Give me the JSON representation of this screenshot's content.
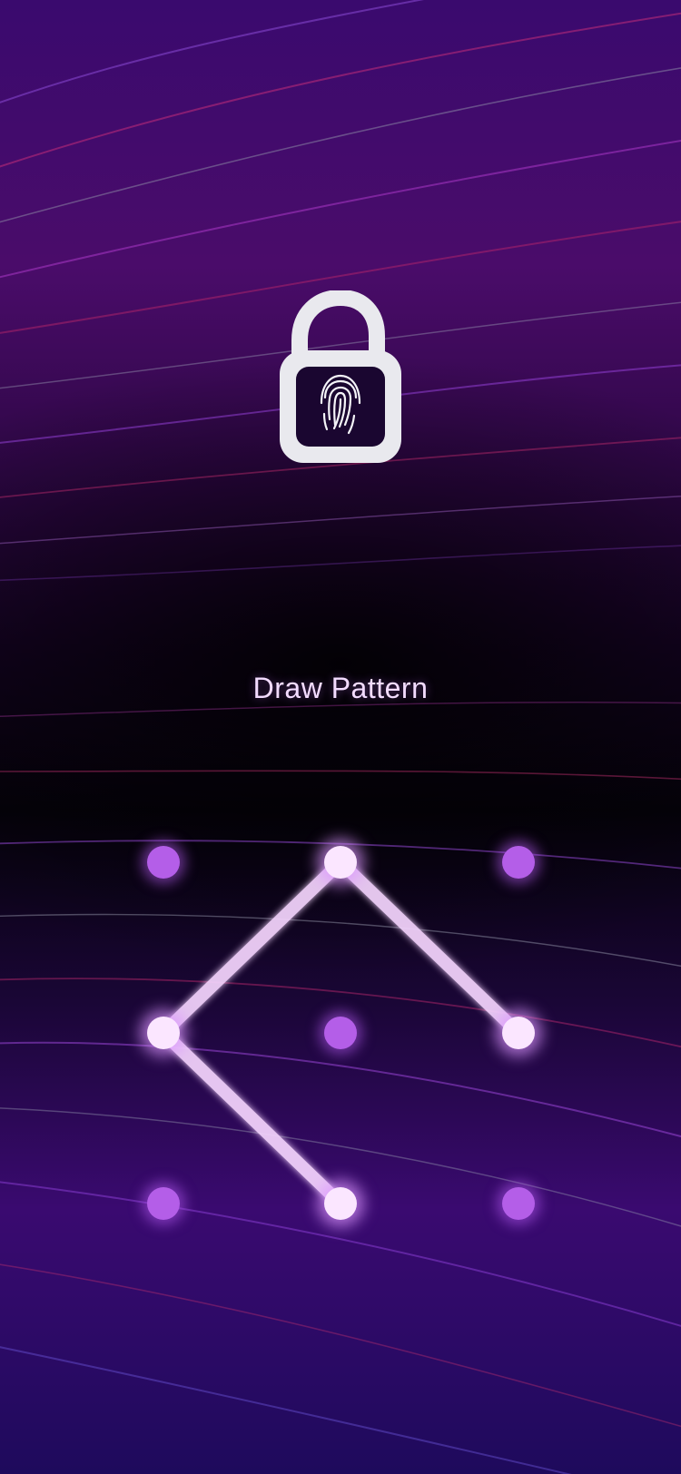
{
  "lock_screen": {
    "title": "Draw Pattern",
    "icon": "padlock-fingerprint-icon",
    "colors": {
      "accent": "#f3dcff",
      "dot_inactive": "#b45ee8",
      "dot_active": "#fbe6ff",
      "path_line": "#f6d6ff"
    }
  },
  "pattern": {
    "grid_size": 3,
    "dots": [
      {
        "index": 1,
        "active": false
      },
      {
        "index": 2,
        "active": true
      },
      {
        "index": 3,
        "active": false
      },
      {
        "index": 4,
        "active": true
      },
      {
        "index": 5,
        "active": false
      },
      {
        "index": 6,
        "active": true
      },
      {
        "index": 7,
        "active": false
      },
      {
        "index": 8,
        "active": true
      },
      {
        "index": 9,
        "active": false
      }
    ],
    "sequence": [
      6,
      2,
      4,
      8
    ]
  }
}
